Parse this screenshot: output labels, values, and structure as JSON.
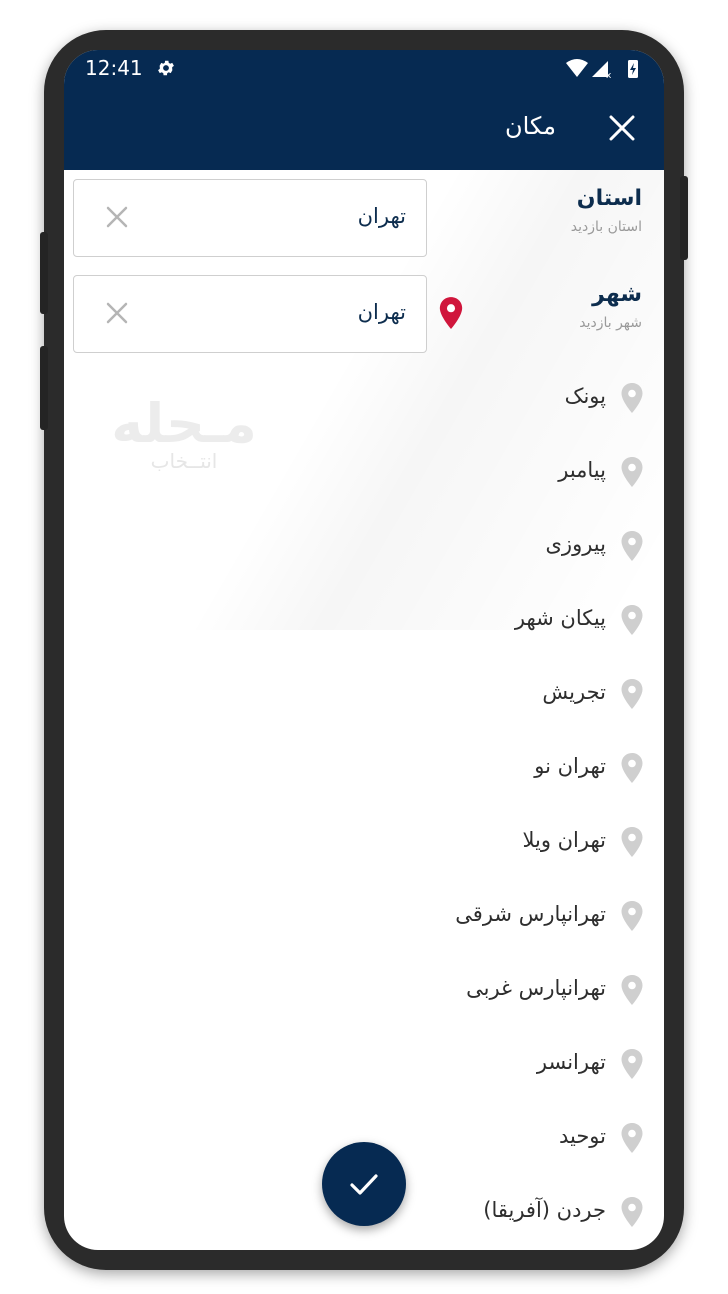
{
  "status": {
    "time": "12:41"
  },
  "appbar": {
    "title": "مکان"
  },
  "province": {
    "label": "استان",
    "sublabel": "استان بازدید",
    "value": "تهران"
  },
  "city": {
    "label": "شهر",
    "sublabel": "شهر بازدید",
    "value": "تهران"
  },
  "watermark": {
    "main": "مـحله",
    "sub": "انتــخاب"
  },
  "cities": [
    "پونک",
    "پیامبر",
    "پیروزی",
    "پیکان شهر",
    "تجریش",
    "تهران نو",
    "تهران ویلا",
    "تهرانپارس شرقی",
    "تهرانپارس غربی",
    "تهرانسر",
    "توحید",
    "جردن (آفریقا)"
  ],
  "colors": {
    "primary": "#062a52",
    "pin_active": "#d0163c",
    "pin_inactive": "#cfcfcf"
  },
  "icons": {
    "close": "close-icon",
    "settings": "gear-icon",
    "confirm": "check-icon",
    "location": "location-pin-icon"
  }
}
